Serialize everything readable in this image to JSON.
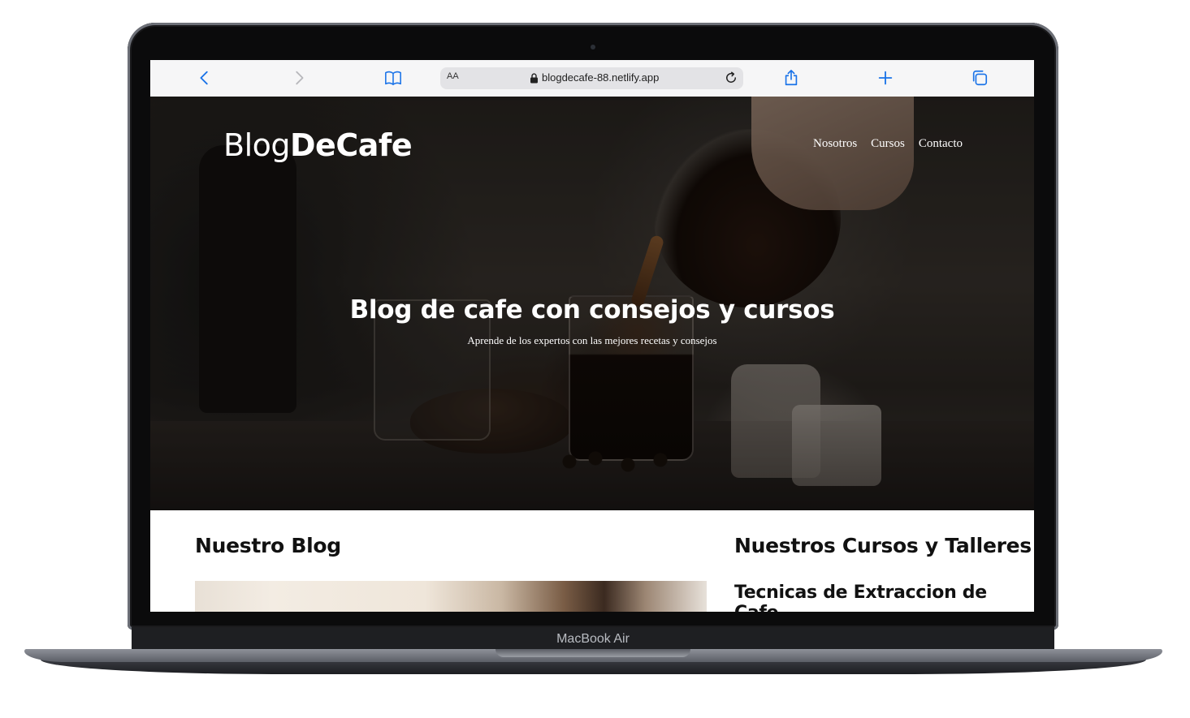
{
  "device": {
    "label": "MacBook Air"
  },
  "browser": {
    "text_size_label": "AA",
    "url": "blogdecafe-88.netlify.app",
    "icons": [
      "back-icon",
      "forward-icon",
      "bookmarks-icon",
      "lock-icon",
      "reload-icon",
      "share-icon",
      "new-tab-icon",
      "tabs-icon"
    ],
    "accent_color": "#1a73e8"
  },
  "site": {
    "logo_light": "Blog",
    "logo_bold": "DeCafe",
    "nav": [
      {
        "label": "Nosotros"
      },
      {
        "label": "Cursos"
      },
      {
        "label": "Contacto"
      }
    ],
    "hero": {
      "title": "Blog de cafe con consejos y cursos",
      "subtitle": "Aprende de los expertos con las mejores recetas y consejos"
    },
    "blog": {
      "heading": "Nuestro Blog"
    },
    "courses": {
      "heading": "Nuestros Cursos y Talleres",
      "items": [
        {
          "title": "Tecnicas de Extraccion de Cafe"
        }
      ]
    }
  }
}
